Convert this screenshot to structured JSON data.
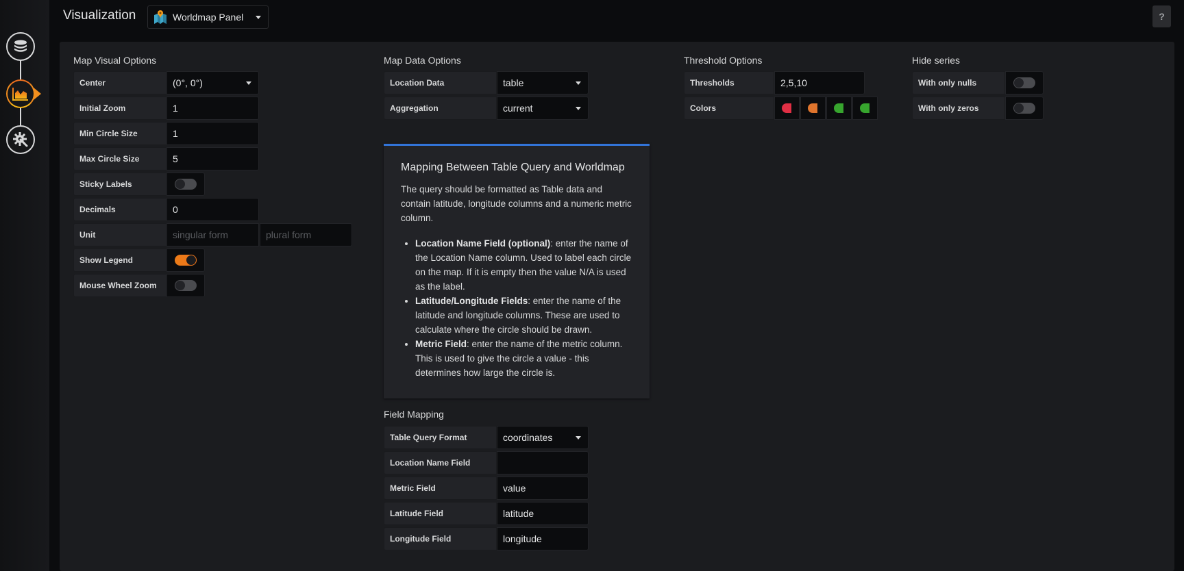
{
  "sidebar": {
    "items": [
      {
        "name": "queries",
        "icon": "database-icon"
      },
      {
        "name": "visualization",
        "icon": "chart-icon",
        "active": true
      },
      {
        "name": "general",
        "icon": "gear-wrench-icon"
      }
    ]
  },
  "header": {
    "title": "Visualization",
    "viz_select": "Worldmap Panel",
    "help_label": "?"
  },
  "map_visual_options": {
    "title": "Map Visual Options",
    "center_label": "Center",
    "center_value": "(0°, 0°)",
    "initial_zoom_label": "Initial Zoom",
    "initial_zoom_value": "1",
    "min_circle_label": "Min Circle Size",
    "min_circle_value": "1",
    "max_circle_label": "Max Circle Size",
    "max_circle_value": "5",
    "sticky_labels_label": "Sticky Labels",
    "sticky_labels_on": false,
    "decimals_label": "Decimals",
    "decimals_value": "0",
    "unit_label": "Unit",
    "unit_singular_placeholder": "singular form",
    "unit_plural_placeholder": "plural form",
    "show_legend_label": "Show Legend",
    "show_legend_on": true,
    "mouse_wheel_label": "Mouse Wheel Zoom",
    "mouse_wheel_on": false
  },
  "map_data_options": {
    "title": "Map Data Options",
    "location_data_label": "Location Data",
    "location_data_value": "table",
    "aggregation_label": "Aggregation",
    "aggregation_value": "current"
  },
  "threshold_options": {
    "title": "Threshold Options",
    "thresholds_label": "Thresholds",
    "thresholds_value": "2,5,10",
    "colors_label": "Colors",
    "colors": [
      "#e02f44",
      "#e0752d",
      "#37a52e",
      "#37a52e"
    ]
  },
  "hide_series": {
    "title": "Hide series",
    "nulls_label": "With only nulls",
    "nulls_on": false,
    "zeros_label": "With only zeros",
    "zeros_on": false
  },
  "info": {
    "title": "Mapping Between Table Query and Worldmap",
    "intro": "The query should be formatted as Table data and contain latitude, longitude columns and a numeric metric column.",
    "items": [
      {
        "term": "Location Name Field (optional)",
        "desc": ": enter the name of the Location Name column. Used to label each circle on the map. If it is empty then the value N/A is used as the label."
      },
      {
        "term": "Latitude/Longitude Fields",
        "desc": ": enter the name of the latitude and longitude columns. These are used to calculate where the circle should be drawn."
      },
      {
        "term": "Metric Field",
        "desc": ": enter the name of the metric column. This is used to give the circle a value - this determines how large the circle is."
      }
    ]
  },
  "field_mapping": {
    "title": "Field Mapping",
    "format_label": "Table Query Format",
    "format_value": "coordinates",
    "location_name_label": "Location Name Field",
    "location_name_value": "",
    "metric_label": "Metric Field",
    "metric_value": "value",
    "latitude_label": "Latitude Field",
    "latitude_value": "latitude",
    "longitude_label": "Longitude Field",
    "longitude_value": "longitude"
  },
  "colors": {
    "accent_orange": "#f0761a",
    "info_border": "#3274d9"
  }
}
